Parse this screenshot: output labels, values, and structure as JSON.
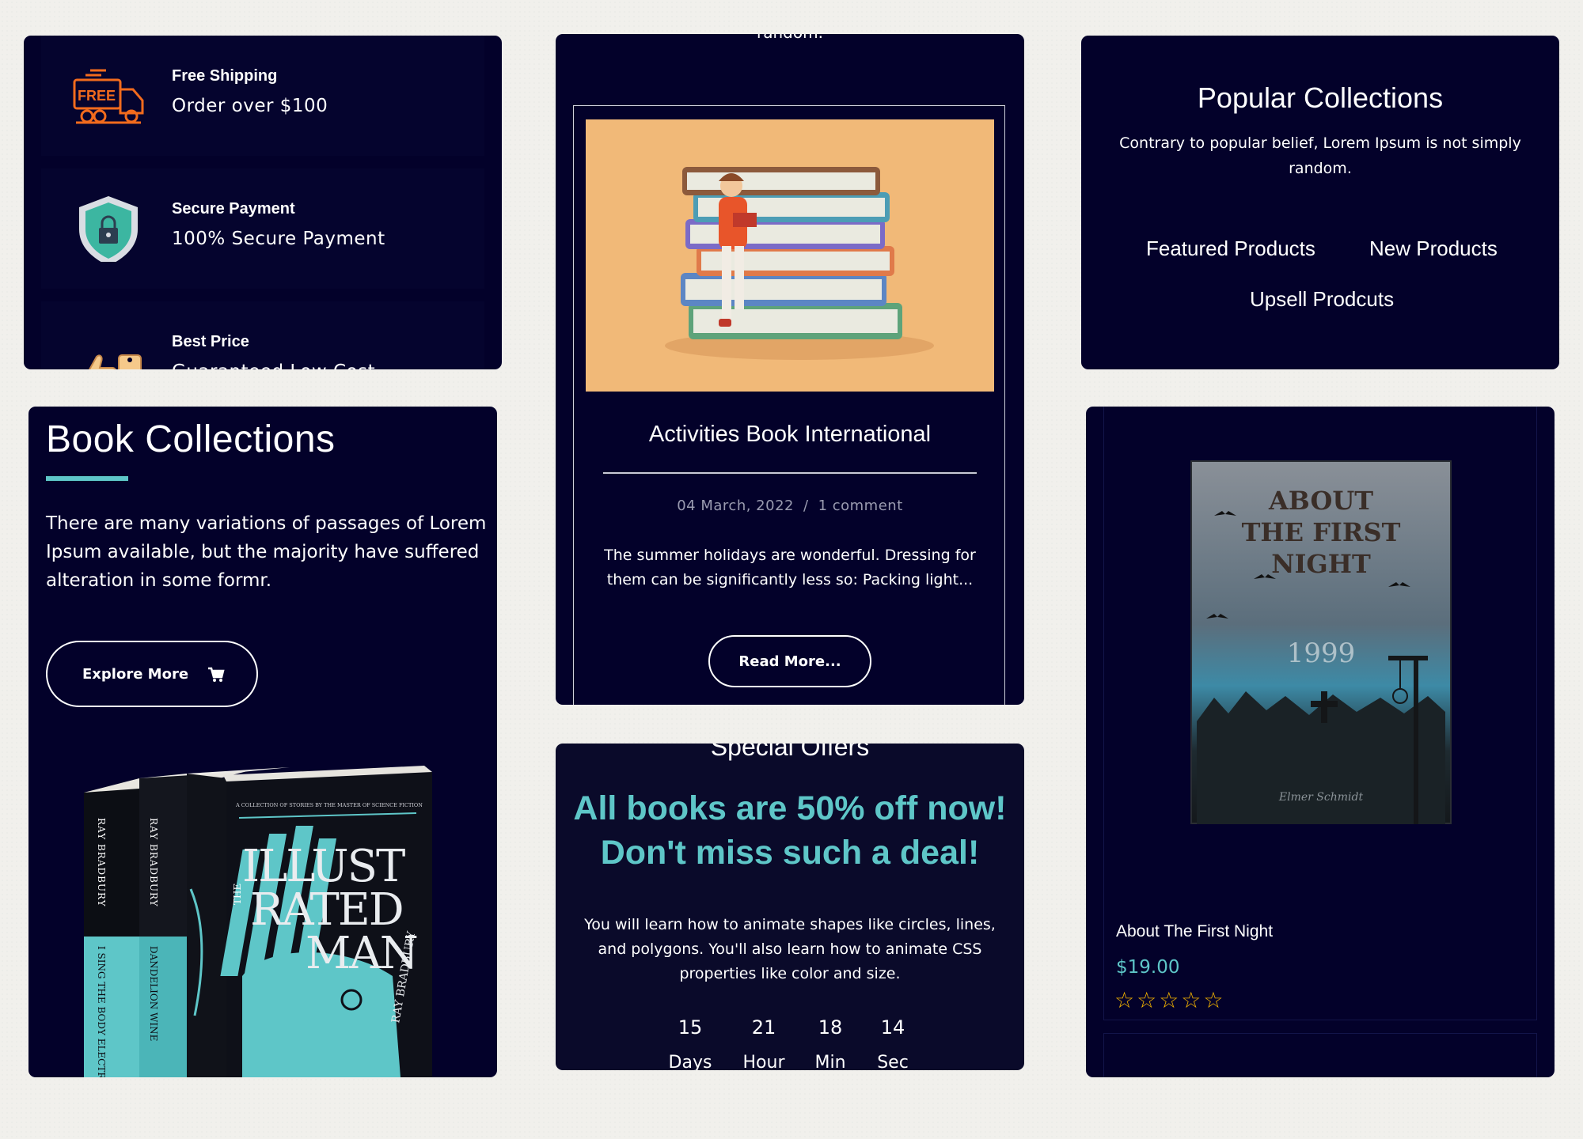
{
  "features": [
    {
      "title": "Free Shipping",
      "subtitle": "Order over $100",
      "icon": "free-truck-icon",
      "badge": "FREE"
    },
    {
      "title": "Secure Payment",
      "subtitle": "100% Secure Payment",
      "icon": "shield-lock-icon"
    },
    {
      "title": "Best Price",
      "subtitle": "Guaranteed Low Cost",
      "icon": "price-tag-thumb-icon"
    }
  ],
  "book_collections": {
    "title": "Book Collections",
    "text": "There are many variations of passages of Lorem Ipsum available, but the majority have suffered alteration in some formr.",
    "button_label": "Explore More",
    "button_icon": "cart-icon",
    "books": {
      "author": "RAY BRADBURY",
      "spine1_title": "I SING THE BODY ELECTRIC",
      "spine2_title": "DANDELION WINE",
      "cover_tagline": "A COLLECTION OF STORIES BY THE MASTER OF SCIENCE FICTION",
      "cover_title_lines": [
        "ILLUST",
        "RATED",
        "MAN"
      ],
      "cover_the": "THE",
      "cover_author": "RAY BRADBURY"
    }
  },
  "blog": {
    "top_text": "random.",
    "title": "Activities Book International",
    "date": "04 March, 2022",
    "separator": "/",
    "comments": "1 comment",
    "excerpt": "The summer holidays are wonderful. Dressing for them can be significantly less so: Packing light...",
    "button_label": "Read More..."
  },
  "offers": {
    "heading": "Special Offers",
    "deal_line1": "All books are 50% off now!",
    "deal_line2": "Don't miss such a deal!",
    "description": "You will learn how to animate shapes like circles, lines, and polygons. You'll also learn how to animate CSS properties like color and size.",
    "countdown": [
      {
        "value": "15",
        "unit": "Days"
      },
      {
        "value": "21",
        "unit": "Hour"
      },
      {
        "value": "18",
        "unit": "Min"
      },
      {
        "value": "14",
        "unit": "Sec"
      }
    ]
  },
  "popular": {
    "title": "Popular Collections",
    "description": "Contrary to popular belief, Lorem Ipsum is not simply random.",
    "tabs": [
      "Featured Products",
      "New Products",
      "Upsell Prodcuts"
    ]
  },
  "product": {
    "cover_title_lines": [
      "ABOUT",
      "THE FIRST",
      "NIGHT"
    ],
    "cover_year": "1999",
    "cover_author": "Elmer Schmidt",
    "name": "About The First Night",
    "price": "$19.00",
    "stars": "☆☆☆☆☆",
    "rating": 0
  },
  "colors": {
    "card_bg": "#03012a",
    "accent": "#5ec6c8",
    "star": "#f4b400",
    "orange_icon": "#f26b1d"
  }
}
